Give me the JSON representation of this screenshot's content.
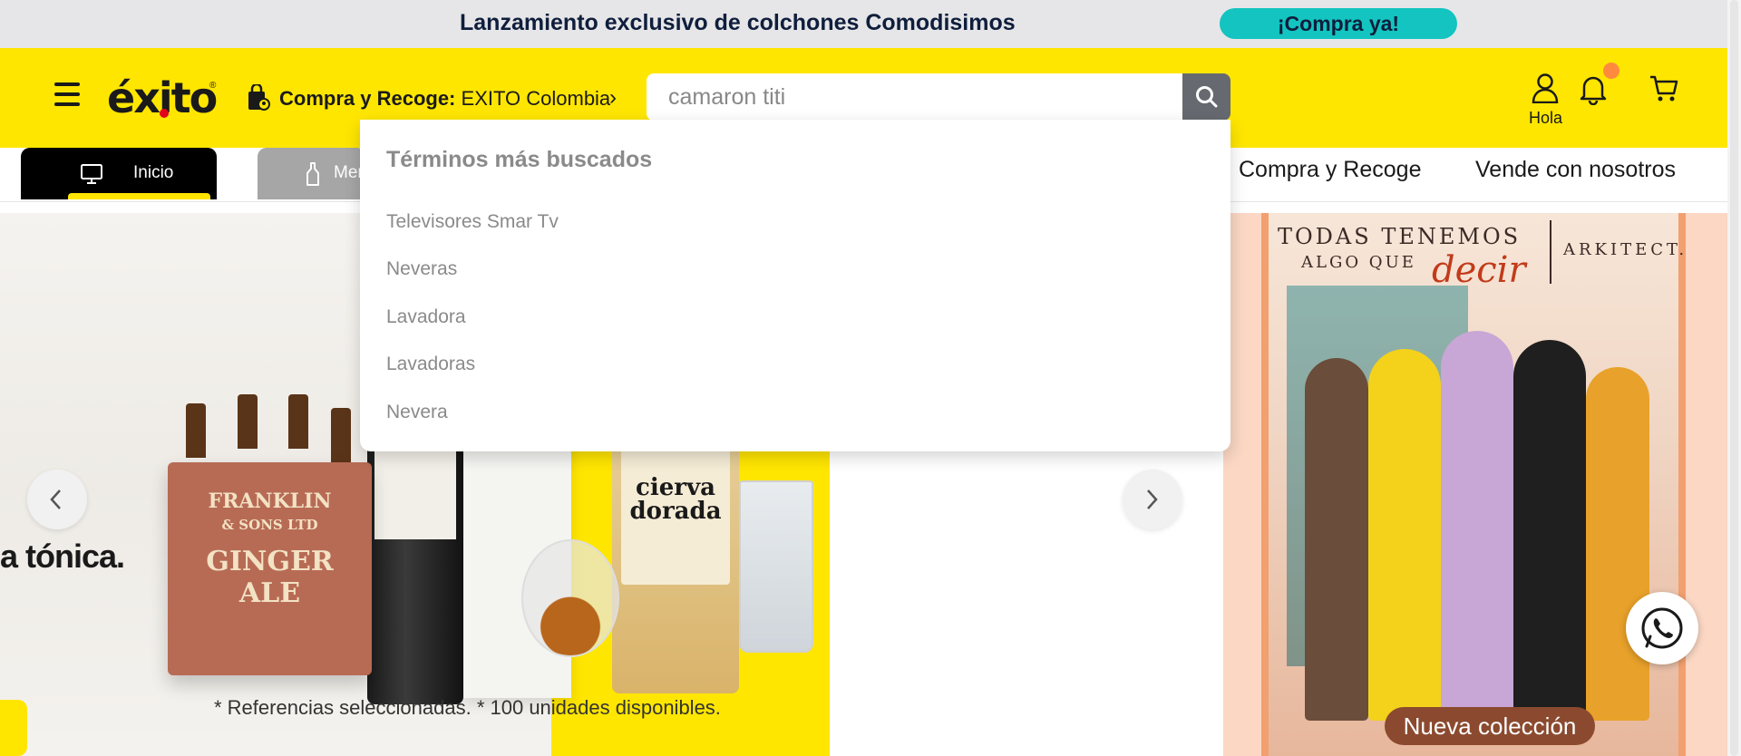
{
  "announcement": {
    "text": "Lanzamiento exclusivo de colchones Comodisimos",
    "cta": "¡Compra ya!"
  },
  "header": {
    "logo": "éxito",
    "logo_reg": "®",
    "store_label": "Compra y Recoge:",
    "store_value": "EXITO Colombia",
    "search_value": "camaron titi",
    "user_label": "Hola"
  },
  "nav": {
    "tabs": [
      {
        "label": "Inicio",
        "icon": "monitor-icon"
      },
      {
        "label": "Mercado",
        "icon": "bottle-icon"
      }
    ],
    "links": [
      "Compra y Recoge",
      "Vende con nosotros"
    ]
  },
  "search_dropdown": {
    "title": "Términos más buscados",
    "items": [
      "Televisores Smar Tv",
      "Neveras",
      "Lavadora",
      "Lavadoras",
      "Nevera"
    ]
  },
  "hero": {
    "tagline": "a tónica.",
    "note": "* Referencias seleccionadas. * 100 unidades disponibles.",
    "box_label": [
      "FRANKLIN",
      "& SONS LTD",
      "GINGER",
      "ALE"
    ],
    "whisky_label": "cierva dorada"
  },
  "promo": {
    "headline_1": "TODAS TENEMOS",
    "headline_2": "ALGO QUE",
    "headline_accent": "decir",
    "brand": "ARKITECT.",
    "pill": "Nueva colección"
  },
  "colors": {
    "brand_yellow": "#ffe600",
    "announce_cta": "#13c4c0",
    "notification_dot": "#ff8a3d"
  }
}
